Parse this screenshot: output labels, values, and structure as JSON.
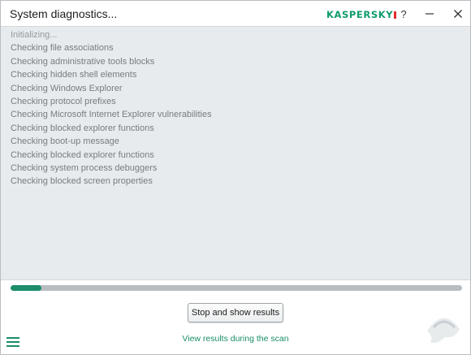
{
  "window": {
    "title": "System diagnostics...",
    "brand": "KASPERSKY",
    "help_label": "?",
    "controls": [
      "minimize-icon",
      "close-icon"
    ]
  },
  "log": {
    "items": [
      "Initializing...",
      "Checking file associations",
      "Checking administrative tools blocks",
      "Checking hidden shell elements",
      "Checking Windows Explorer",
      "Checking protocol prefixes",
      "Checking Microsoft Internet Explorer vulnerabilities",
      "Checking blocked explorer functions",
      "Checking boot-up message",
      "Checking blocked explorer functions",
      "Checking system process debuggers",
      "Checking blocked screen properties"
    ]
  },
  "progress": {
    "fraction": 0.068
  },
  "actions": {
    "stop_label": "Stop and show results",
    "view_link": "View results during the scan"
  },
  "icons": {
    "menu": "hamburger-menu-icon",
    "watermark": "watermark-logo"
  },
  "colors": {
    "accent": "#1b8d6a",
    "brand_green": "#0f9b6e",
    "brand_red": "#e32b2b",
    "log_background": "#e7ebed",
    "progress_track": "#b7bdc1"
  }
}
